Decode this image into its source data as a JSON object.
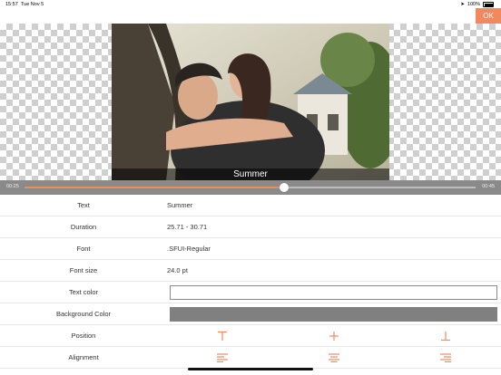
{
  "status": {
    "time": "15:57",
    "date": "Tue Nov 5",
    "battery": "100%"
  },
  "ok_label": "OK",
  "caption": "Summer",
  "timeline": {
    "start": "00:25",
    "end": "00:45",
    "progress": 0.575
  },
  "props": {
    "text_label": "Text",
    "text_value": "Summer",
    "duration_label": "Duration",
    "duration_value": "25.71 - 30.71",
    "font_label": "Font",
    "font_value": ".SFUI-Regular",
    "fontsize_label": "Font size",
    "fontsize_value": "24.0 pt",
    "textcolor_label": "Text color",
    "textcolor_value": "#ffffff",
    "bgcolor_label": "Background Color",
    "bgcolor_value": "#808080",
    "position_label": "Position",
    "alignment_label": "Alignment"
  },
  "colors": {
    "accent": "#f08a5d"
  },
  "icons": {
    "position": [
      "position-top-icon",
      "position-center-icon",
      "position-bottom-icon"
    ],
    "alignment": [
      "align-left-icon",
      "align-center-icon",
      "align-right-icon"
    ]
  }
}
